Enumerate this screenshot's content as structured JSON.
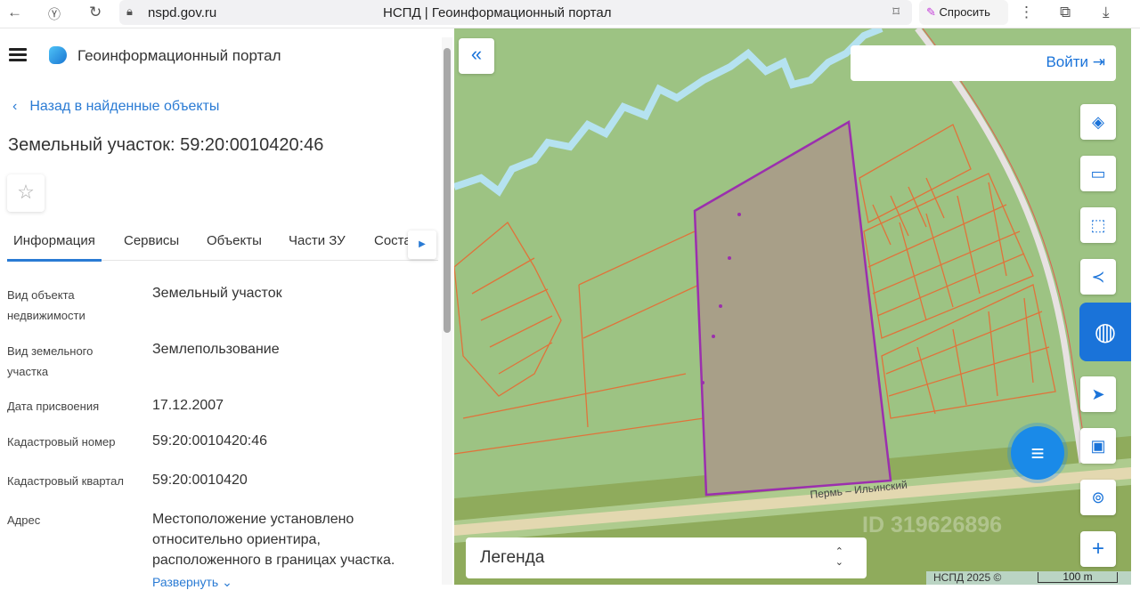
{
  "browser": {
    "url": "nspd.gov.ru",
    "tab_title": "НСПД | Геоинформационный портал",
    "ask_label": "Спросить"
  },
  "header": {
    "title": "Геоинформационный портал"
  },
  "back_link": "Назад в найденные объекты",
  "object_title": "Земельный участок: 59:20:0010420:46",
  "tabs": [
    "Информация",
    "Сервисы",
    "Объекты",
    "Части ЗУ",
    "Соста"
  ],
  "fields": [
    {
      "label": "Вид объекта недвижимости",
      "value": "Земельный участок"
    },
    {
      "label": "Вид земельного участка",
      "value": "Землепользование"
    },
    {
      "label": "Дата присвоения",
      "value": "17.12.2007"
    },
    {
      "label": "Кадастровый номер",
      "value": "59:20:0010420:46"
    },
    {
      "label": "Кадастровый квартал",
      "value": "59:20:0010420"
    },
    {
      "label": "Адрес",
      "value": "Местоположение установлено относительно ориентира, расположенного в границах участка."
    }
  ],
  "expand_label": "Развернуть",
  "map": {
    "login_label": "Войти",
    "legend_label": "Легенда",
    "road_label": "Пермь – Ильинский",
    "watermark": "ID 319626896",
    "copyright": "НСПД 2025 ©",
    "scale_label": "100 m",
    "parcel_color": "#9b2fae",
    "accent": "#1a73d9"
  }
}
